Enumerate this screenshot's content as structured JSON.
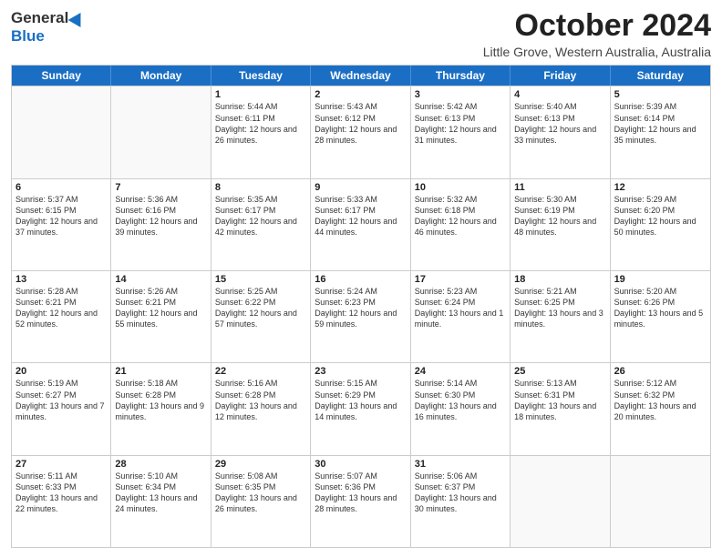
{
  "logo": {
    "general": "General",
    "blue": "Blue"
  },
  "header": {
    "month": "October 2024",
    "location": "Little Grove, Western Australia, Australia"
  },
  "weekdays": [
    "Sunday",
    "Monday",
    "Tuesday",
    "Wednesday",
    "Thursday",
    "Friday",
    "Saturday"
  ],
  "rows": [
    [
      {
        "day": "",
        "sunrise": "",
        "sunset": "",
        "daylight": ""
      },
      {
        "day": "",
        "sunrise": "",
        "sunset": "",
        "daylight": ""
      },
      {
        "day": "1",
        "sunrise": "Sunrise: 5:44 AM",
        "sunset": "Sunset: 6:11 PM",
        "daylight": "Daylight: 12 hours and 26 minutes."
      },
      {
        "day": "2",
        "sunrise": "Sunrise: 5:43 AM",
        "sunset": "Sunset: 6:12 PM",
        "daylight": "Daylight: 12 hours and 28 minutes."
      },
      {
        "day": "3",
        "sunrise": "Sunrise: 5:42 AM",
        "sunset": "Sunset: 6:13 PM",
        "daylight": "Daylight: 12 hours and 31 minutes."
      },
      {
        "day": "4",
        "sunrise": "Sunrise: 5:40 AM",
        "sunset": "Sunset: 6:13 PM",
        "daylight": "Daylight: 12 hours and 33 minutes."
      },
      {
        "day": "5",
        "sunrise": "Sunrise: 5:39 AM",
        "sunset": "Sunset: 6:14 PM",
        "daylight": "Daylight: 12 hours and 35 minutes."
      }
    ],
    [
      {
        "day": "6",
        "sunrise": "Sunrise: 5:37 AM",
        "sunset": "Sunset: 6:15 PM",
        "daylight": "Daylight: 12 hours and 37 minutes."
      },
      {
        "day": "7",
        "sunrise": "Sunrise: 5:36 AM",
        "sunset": "Sunset: 6:16 PM",
        "daylight": "Daylight: 12 hours and 39 minutes."
      },
      {
        "day": "8",
        "sunrise": "Sunrise: 5:35 AM",
        "sunset": "Sunset: 6:17 PM",
        "daylight": "Daylight: 12 hours and 42 minutes."
      },
      {
        "day": "9",
        "sunrise": "Sunrise: 5:33 AM",
        "sunset": "Sunset: 6:17 PM",
        "daylight": "Daylight: 12 hours and 44 minutes."
      },
      {
        "day": "10",
        "sunrise": "Sunrise: 5:32 AM",
        "sunset": "Sunset: 6:18 PM",
        "daylight": "Daylight: 12 hours and 46 minutes."
      },
      {
        "day": "11",
        "sunrise": "Sunrise: 5:30 AM",
        "sunset": "Sunset: 6:19 PM",
        "daylight": "Daylight: 12 hours and 48 minutes."
      },
      {
        "day": "12",
        "sunrise": "Sunrise: 5:29 AM",
        "sunset": "Sunset: 6:20 PM",
        "daylight": "Daylight: 12 hours and 50 minutes."
      }
    ],
    [
      {
        "day": "13",
        "sunrise": "Sunrise: 5:28 AM",
        "sunset": "Sunset: 6:21 PM",
        "daylight": "Daylight: 12 hours and 52 minutes."
      },
      {
        "day": "14",
        "sunrise": "Sunrise: 5:26 AM",
        "sunset": "Sunset: 6:21 PM",
        "daylight": "Daylight: 12 hours and 55 minutes."
      },
      {
        "day": "15",
        "sunrise": "Sunrise: 5:25 AM",
        "sunset": "Sunset: 6:22 PM",
        "daylight": "Daylight: 12 hours and 57 minutes."
      },
      {
        "day": "16",
        "sunrise": "Sunrise: 5:24 AM",
        "sunset": "Sunset: 6:23 PM",
        "daylight": "Daylight: 12 hours and 59 minutes."
      },
      {
        "day": "17",
        "sunrise": "Sunrise: 5:23 AM",
        "sunset": "Sunset: 6:24 PM",
        "daylight": "Daylight: 13 hours and 1 minute."
      },
      {
        "day": "18",
        "sunrise": "Sunrise: 5:21 AM",
        "sunset": "Sunset: 6:25 PM",
        "daylight": "Daylight: 13 hours and 3 minutes."
      },
      {
        "day": "19",
        "sunrise": "Sunrise: 5:20 AM",
        "sunset": "Sunset: 6:26 PM",
        "daylight": "Daylight: 13 hours and 5 minutes."
      }
    ],
    [
      {
        "day": "20",
        "sunrise": "Sunrise: 5:19 AM",
        "sunset": "Sunset: 6:27 PM",
        "daylight": "Daylight: 13 hours and 7 minutes."
      },
      {
        "day": "21",
        "sunrise": "Sunrise: 5:18 AM",
        "sunset": "Sunset: 6:28 PM",
        "daylight": "Daylight: 13 hours and 9 minutes."
      },
      {
        "day": "22",
        "sunrise": "Sunrise: 5:16 AM",
        "sunset": "Sunset: 6:28 PM",
        "daylight": "Daylight: 13 hours and 12 minutes."
      },
      {
        "day": "23",
        "sunrise": "Sunrise: 5:15 AM",
        "sunset": "Sunset: 6:29 PM",
        "daylight": "Daylight: 13 hours and 14 minutes."
      },
      {
        "day": "24",
        "sunrise": "Sunrise: 5:14 AM",
        "sunset": "Sunset: 6:30 PM",
        "daylight": "Daylight: 13 hours and 16 minutes."
      },
      {
        "day": "25",
        "sunrise": "Sunrise: 5:13 AM",
        "sunset": "Sunset: 6:31 PM",
        "daylight": "Daylight: 13 hours and 18 minutes."
      },
      {
        "day": "26",
        "sunrise": "Sunrise: 5:12 AM",
        "sunset": "Sunset: 6:32 PM",
        "daylight": "Daylight: 13 hours and 20 minutes."
      }
    ],
    [
      {
        "day": "27",
        "sunrise": "Sunrise: 5:11 AM",
        "sunset": "Sunset: 6:33 PM",
        "daylight": "Daylight: 13 hours and 22 minutes."
      },
      {
        "day": "28",
        "sunrise": "Sunrise: 5:10 AM",
        "sunset": "Sunset: 6:34 PM",
        "daylight": "Daylight: 13 hours and 24 minutes."
      },
      {
        "day": "29",
        "sunrise": "Sunrise: 5:08 AM",
        "sunset": "Sunset: 6:35 PM",
        "daylight": "Daylight: 13 hours and 26 minutes."
      },
      {
        "day": "30",
        "sunrise": "Sunrise: 5:07 AM",
        "sunset": "Sunset: 6:36 PM",
        "daylight": "Daylight: 13 hours and 28 minutes."
      },
      {
        "day": "31",
        "sunrise": "Sunrise: 5:06 AM",
        "sunset": "Sunset: 6:37 PM",
        "daylight": "Daylight: 13 hours and 30 minutes."
      },
      {
        "day": "",
        "sunrise": "",
        "sunset": "",
        "daylight": ""
      },
      {
        "day": "",
        "sunrise": "",
        "sunset": "",
        "daylight": ""
      }
    ]
  ]
}
